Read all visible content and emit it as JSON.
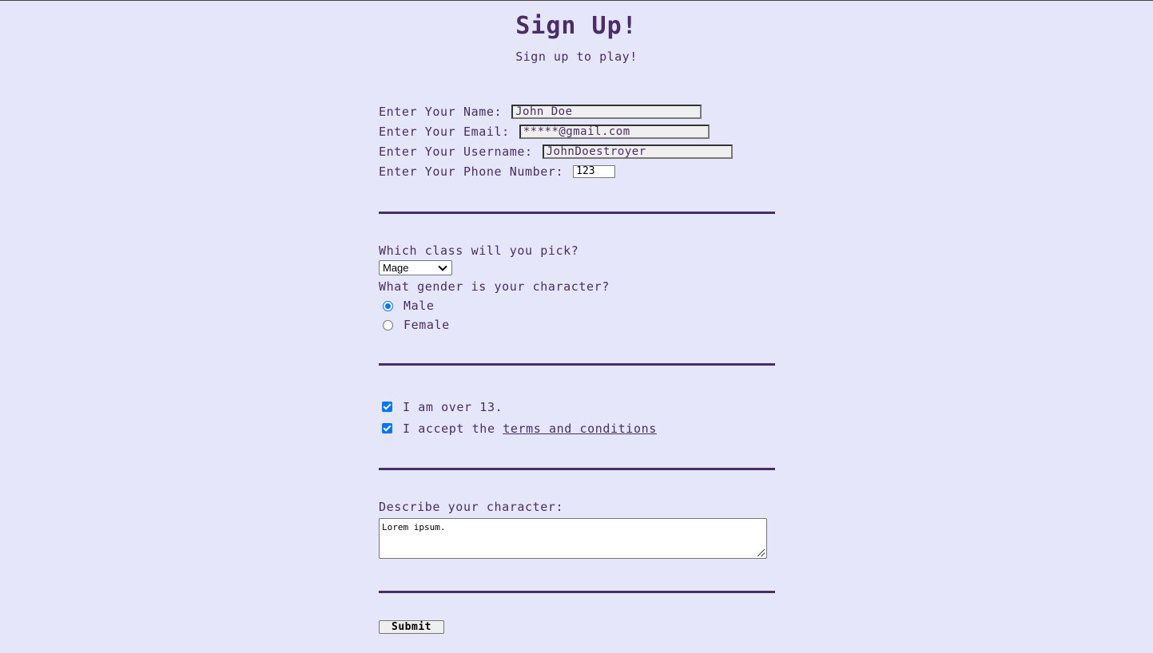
{
  "header": {
    "title": "Sign Up!",
    "subtitle": "Sign up to play!"
  },
  "account": {
    "name_label": "Enter Your Name:",
    "name_value": "John Doe",
    "email_label": "Enter Your Email:",
    "email_value": "*****@gmail.com",
    "username_label": "Enter Your Username:",
    "username_value": "JohnDoestroyer",
    "phone_label": "Enter Your Phone Number:",
    "phone_value": "123"
  },
  "character": {
    "class_question": "Which class will you pick?",
    "class_selected": "Mage",
    "gender_question": "What gender is your character?",
    "gender_options": [
      "Male",
      "Female"
    ],
    "gender_selected": "Male"
  },
  "agreements": {
    "age_label": "I am over 13.",
    "age_checked": true,
    "terms_prefix": "I accept the",
    "terms_link": "terms and conditions",
    "terms_checked": true
  },
  "description": {
    "label": "Describe your character:",
    "value": "Lorem ipsum."
  },
  "actions": {
    "submit_label": "Submit"
  },
  "colors": {
    "background": "#e6e6fa",
    "text": "#4a2d66",
    "accent": "#0075ff"
  }
}
